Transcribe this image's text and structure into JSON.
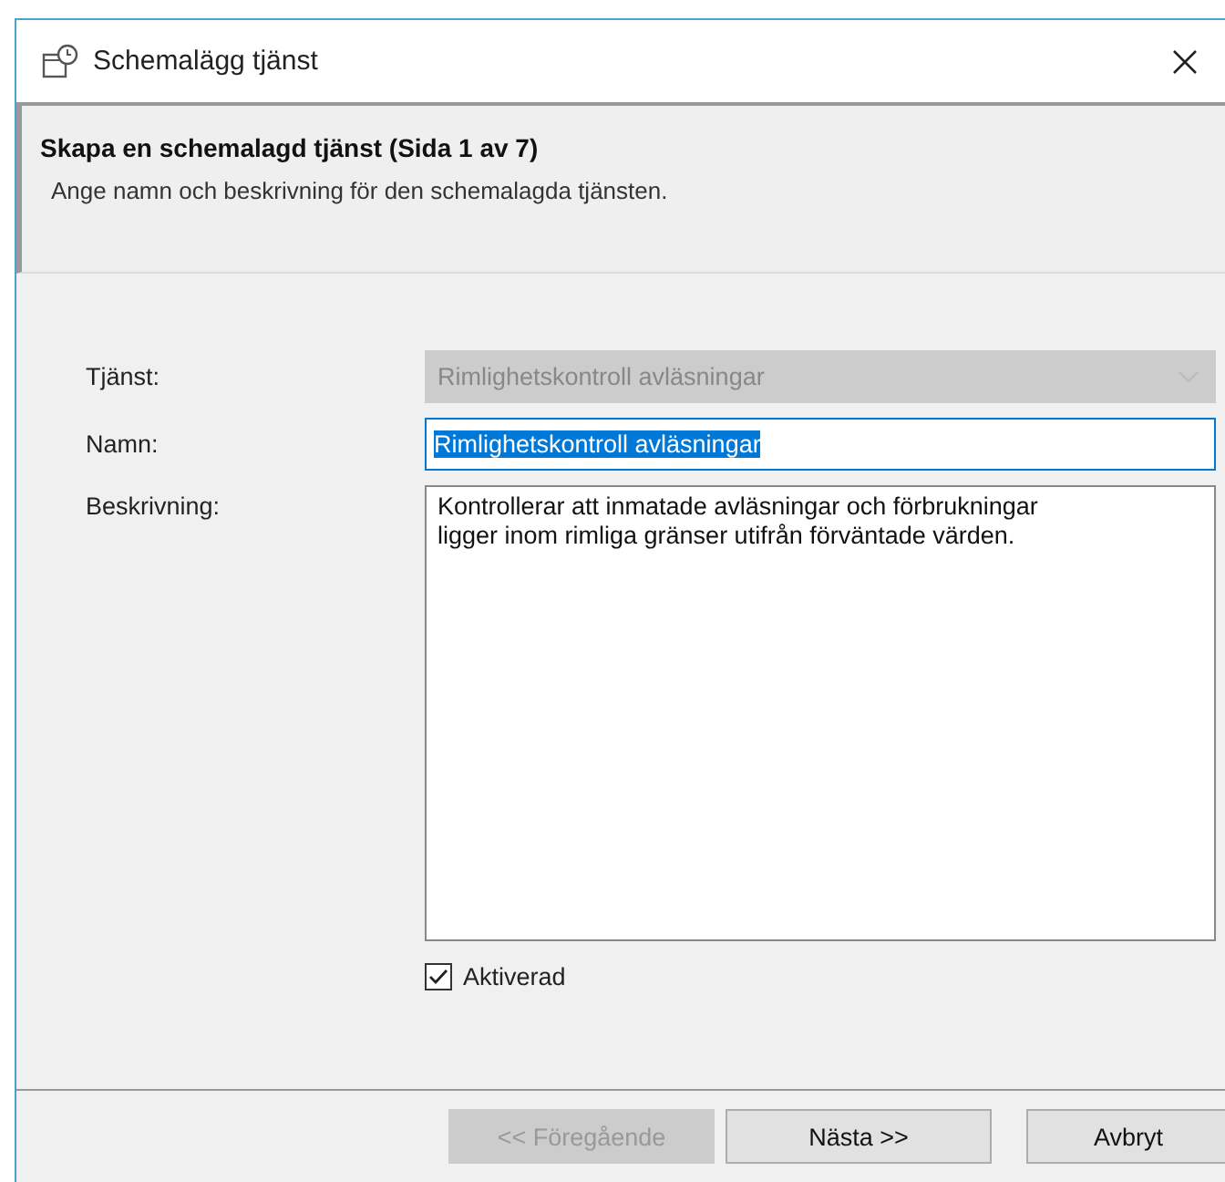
{
  "window": {
    "title": "Schemalägg tjänst"
  },
  "header": {
    "title": "Skapa en schemalagd tjänst (Sida 1 av 7)",
    "subtitle": "Ange namn och beskrivning för den schemalagda tjänsten."
  },
  "fields": [
    {
      "kind": "combo",
      "label": "Tjänst:",
      "value": "Rimlighetskontroll avläsningar",
      "disabled": true
    },
    {
      "kind": "text",
      "label": "Namn:",
      "value": "Rimlighetskontroll avläsningar",
      "disabled": false,
      "selected": true
    },
    {
      "kind": "textarea",
      "label": "Beskrivning:",
      "value": "Kontrollerar att inmatade avläsningar och förbrukningar ligger inom rimliga gränser utifrån förväntade värden.",
      "disabled": false
    }
  ],
  "checkbox": {
    "label": "Aktiverad",
    "checked": true
  },
  "buttons": [
    {
      "label": "<< Föregående",
      "disabled": true
    },
    {
      "label": "Nästa >>",
      "disabled": false
    },
    {
      "label": "Avbryt",
      "disabled": false
    }
  ]
}
